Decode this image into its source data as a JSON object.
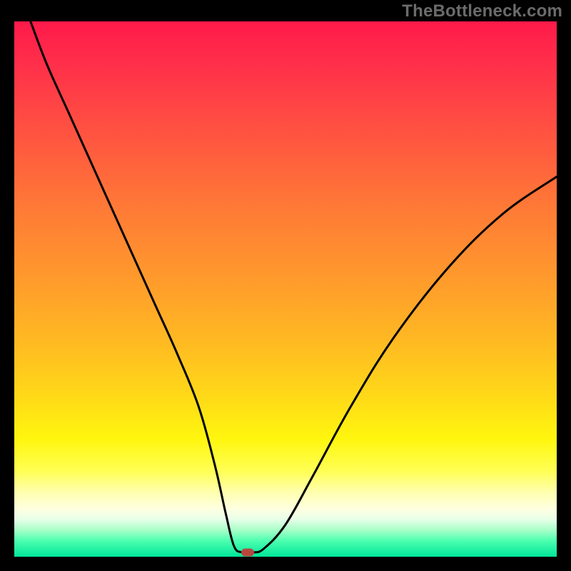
{
  "watermark": "TheBottleneck.com",
  "chart_data": {
    "type": "line",
    "title": "",
    "xlabel": "",
    "ylabel": "",
    "xlim": [
      0,
      100
    ],
    "ylim": [
      0,
      100
    ],
    "grid": false,
    "legend": false,
    "background": {
      "gradient": "vertical",
      "stops": [
        {
          "pos": 0,
          "color": "#ff1a4a"
        },
        {
          "pos": 50,
          "color": "#ff9a2c"
        },
        {
          "pos": 78,
          "color": "#fff60e"
        },
        {
          "pos": 100,
          "color": "#00e69a"
        }
      ]
    },
    "series": [
      {
        "name": "bottleneck-curve",
        "x": [
          3,
          6,
          10,
          14,
          18,
          22,
          26,
          30,
          34,
          37,
          39,
          40.5,
          42,
          44,
          46,
          50,
          55,
          62,
          70,
          80,
          90,
          100
        ],
        "y": [
          100,
          92,
          83,
          74,
          65,
          56,
          47,
          38,
          28,
          17,
          8,
          2,
          0.8,
          0.8,
          1.5,
          6,
          15,
          28,
          41,
          54,
          64,
          71
        ],
        "color": "#000000",
        "linewidth": 3
      }
    ],
    "markers": [
      {
        "name": "target-point",
        "x": 43,
        "y": 0.8,
        "color": "#b6473f",
        "shape": "rounded-rect"
      }
    ]
  }
}
